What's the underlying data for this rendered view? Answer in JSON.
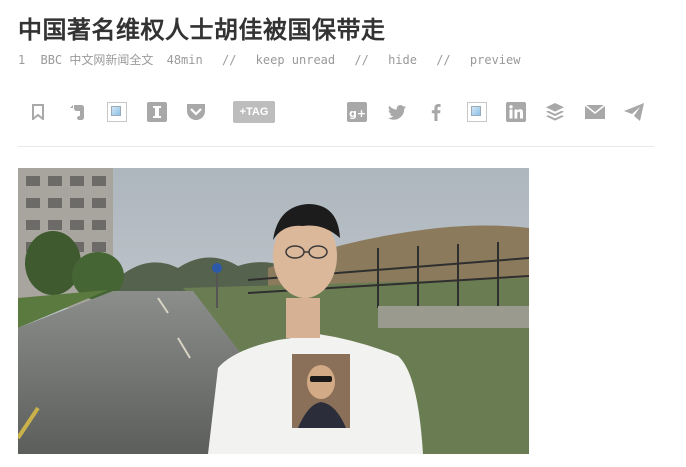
{
  "article": {
    "title": "中国著名维权人士胡佳被国保带走",
    "meta": {
      "count": "1",
      "source": "BBC 中文网新闻全文",
      "age": "48min",
      "sep": "//",
      "keep_unread": "keep unread",
      "hide": "hide",
      "preview": "preview"
    }
  },
  "toolbar": {
    "tag_label": "+TAG",
    "icons": [
      "bookmark-icon",
      "evernote-icon",
      "broken-image-icon",
      "instapaper-icon",
      "pocket-icon",
      "google-plus-icon",
      "twitter-icon",
      "facebook-icon",
      "broken-image-icon",
      "linkedin-icon",
      "buffer-icon",
      "email-icon",
      "send-icon"
    ]
  },
  "colors": {
    "text": "#333333",
    "muted": "#9a9a9a",
    "icon": "#a8a8a8"
  }
}
